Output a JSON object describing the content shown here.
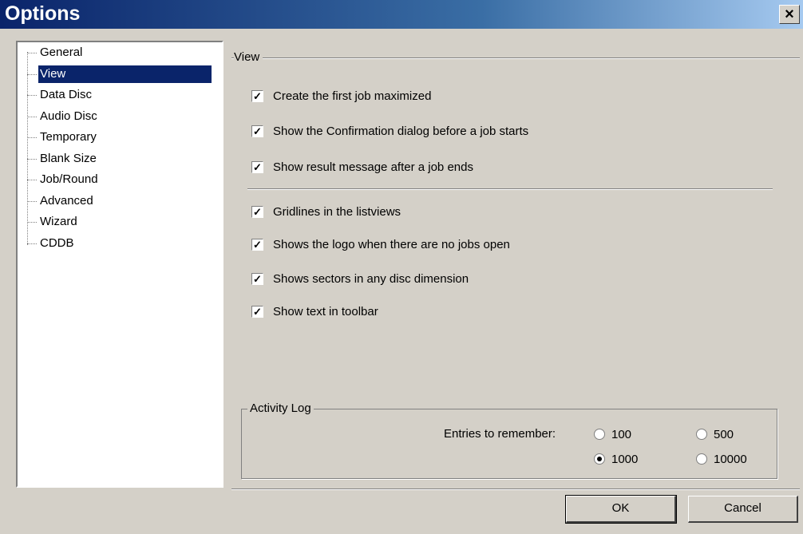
{
  "window": {
    "title": "Options",
    "close_glyph": "×"
  },
  "tree": {
    "items": [
      {
        "label": "General"
      },
      {
        "label": "View",
        "selected": true
      },
      {
        "label": "Data Disc"
      },
      {
        "label": "Audio Disc"
      },
      {
        "label": "Temporary"
      },
      {
        "label": "Blank Size"
      },
      {
        "label": "Job/Round"
      },
      {
        "label": "Advanced"
      },
      {
        "label": "Wizard"
      },
      {
        "label": "CDDB"
      }
    ]
  },
  "view": {
    "group_label": "View",
    "checkboxes": [
      {
        "label": "Create the first job maximized",
        "checked": true
      },
      {
        "label": "Show the Confirmation dialog before a job starts",
        "checked": true
      },
      {
        "label": "Show result message after a job ends",
        "checked": true
      },
      {
        "label": "Gridlines in the listviews",
        "checked": true
      },
      {
        "label": "Shows the logo when there are no jobs open",
        "checked": true
      },
      {
        "label": "Shows sectors in any disc dimension",
        "checked": true
      },
      {
        "label": "Show text in toolbar",
        "checked": true
      }
    ]
  },
  "activity_log": {
    "group_label": "Activity Log",
    "entries_label": "Entries to remember:",
    "options": [
      {
        "label": "100",
        "selected": false
      },
      {
        "label": "500",
        "selected": false
      },
      {
        "label": "1000",
        "selected": true
      },
      {
        "label": "10000",
        "selected": false
      }
    ]
  },
  "buttons": {
    "ok": "OK",
    "cancel": "Cancel"
  },
  "colors": {
    "title_start": "#0a246a",
    "selection": "#0a246a",
    "face": "#d4d0c8"
  }
}
